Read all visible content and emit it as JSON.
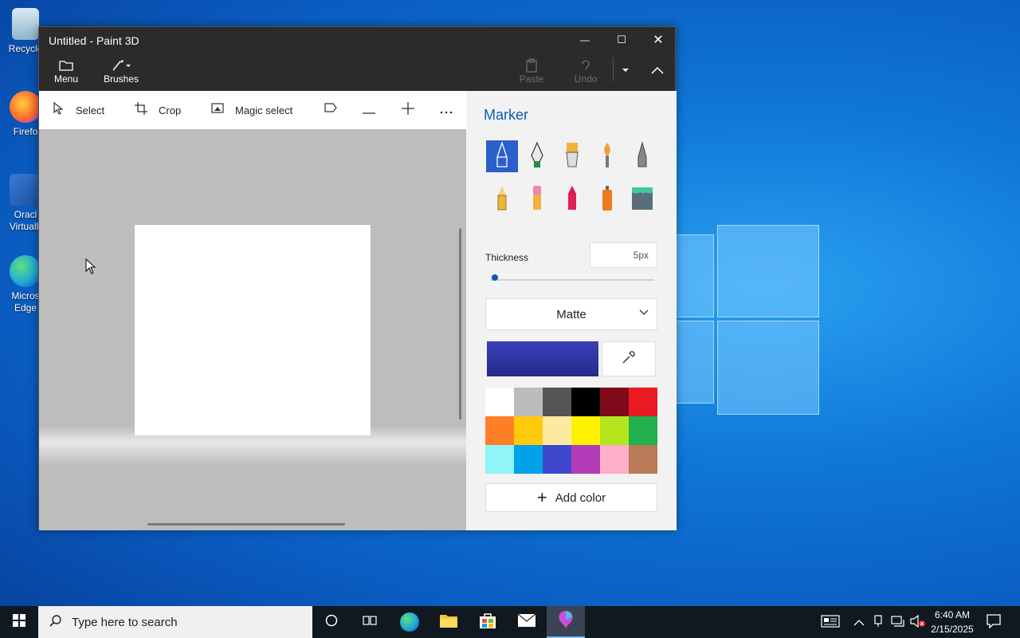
{
  "desktop": {
    "icons": [
      {
        "label": "Recycle",
        "name": "recycle-bin"
      },
      {
        "label": "Firefo",
        "name": "firefox"
      },
      {
        "label": "Oracl Virtualb",
        "name": "oracle-virtualbox"
      },
      {
        "label": "Micros Edge",
        "name": "microsoft-edge"
      }
    ]
  },
  "window": {
    "title": "Untitled - Paint 3D",
    "controls": {
      "minimize": "—",
      "maximize": "☐",
      "close": "✕"
    },
    "toolbar": {
      "menu_label": "Menu",
      "brushes_label": "Brushes",
      "paste_label": "Paste",
      "undo_label": "Undo"
    },
    "tools": {
      "select_label": "Select",
      "crop_label": "Crop",
      "magic_select_label": "Magic select"
    }
  },
  "panel": {
    "title": "Marker",
    "brushes": [
      {
        "name": "marker",
        "selected": true
      },
      {
        "name": "calligraphy-pen",
        "selected": false
      },
      {
        "name": "oil-brush",
        "selected": false
      },
      {
        "name": "watercolor",
        "selected": false
      },
      {
        "name": "pixel-pen",
        "selected": false
      },
      {
        "name": "pencil",
        "selected": false
      },
      {
        "name": "eraser",
        "selected": false
      },
      {
        "name": "crayon",
        "selected": false
      },
      {
        "name": "spray-can",
        "selected": false
      },
      {
        "name": "fill-bucket",
        "selected": false
      }
    ],
    "thickness_label": "Thickness",
    "thickness_value": "5px",
    "finish": "Matte",
    "add_color_label": "Add color",
    "current_color": "#3a40b8",
    "swatches": [
      "#ffffff",
      "#bcbcbc",
      "#555555",
      "#000000",
      "#7f0a1a",
      "#e81b23",
      "#ff7f27",
      "#ffc90e",
      "#fde9a0",
      "#fff200",
      "#b5e61d",
      "#22b14c",
      "#8ff5f5",
      "#00a2e8",
      "#3f48cc",
      "#b23cb8",
      "#ffaec9",
      "#b97a57"
    ]
  },
  "taskbar": {
    "search_placeholder": "Type here to search",
    "time": "6:40 AM",
    "date": "2/15/2025"
  }
}
